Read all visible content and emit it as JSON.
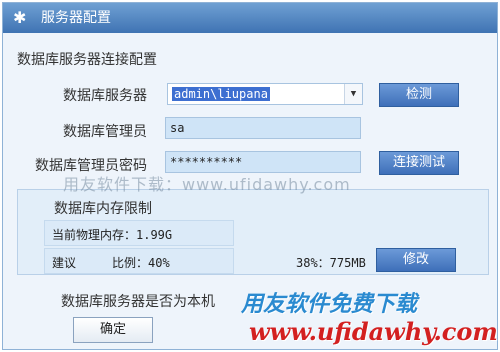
{
  "window": {
    "title": "服务器配置",
    "icon": "gear-icon"
  },
  "connection": {
    "group_label": "数据库服务器连接配置",
    "server_label": "数据库服务器",
    "server_value": "admin\\liupana",
    "check_button": "检测",
    "admin_label": "数据库管理员",
    "admin_value": "sa",
    "password_label": "数据库管理员密码",
    "password_value": "**********",
    "test_button": "连接测试"
  },
  "memory": {
    "title": "数据库内存限制",
    "physical_label": "当前物理内存：1.99G",
    "suggest_label": "建议",
    "ratio_label": "比例：40%",
    "ratio_value": "38%：775MB",
    "modify_button": "修改"
  },
  "local": {
    "label": "数据库服务器是否为本机",
    "ok_button": "确定"
  },
  "watermarks": {
    "center": "用友软件下载：www.ufidawhy.com",
    "brand_cn": "用友软件免费下载",
    "brand_url": "www.ufidawhy.com"
  },
  "colors": {
    "titlebar": "#4a7fbf",
    "button": "#4f80c6",
    "accent_watermark": "#d32020"
  }
}
